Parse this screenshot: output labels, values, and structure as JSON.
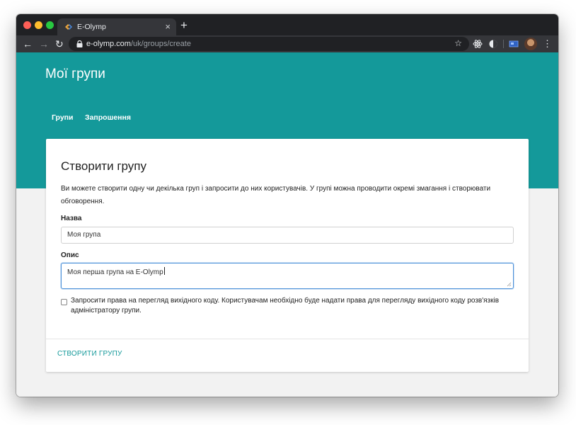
{
  "browser": {
    "tab_title": "E-Olymp",
    "tab_close": "×",
    "new_tab": "+",
    "url_host": "e-olymp.com",
    "url_path": "/uk/groups/create"
  },
  "page": {
    "title": "Мої групи",
    "nav": [
      {
        "label": "Групи"
      },
      {
        "label": "Запрошення"
      }
    ]
  },
  "form": {
    "heading": "Створити групу",
    "description": "Ви можете створити одну чи декілька груп і запросити до них користувачів. У групі можна проводити окремі змагання і створювати обговорення.",
    "name_label": "Назва",
    "name_value": "Моя група",
    "description_label": "Опис",
    "description_value": "Моя перша група на E-Olymp",
    "checkbox_label": "Запросити права на перегляд вихідного коду. Користувачам необхідно буде надати права для перегляду вихідного коду розв'язків адміністратору групи.",
    "checkbox_checked": false,
    "submit_label": "СТВОРИТИ ГРУПУ"
  },
  "colors": {
    "brand": "#14999a",
    "focus": "#4a90d9"
  }
}
